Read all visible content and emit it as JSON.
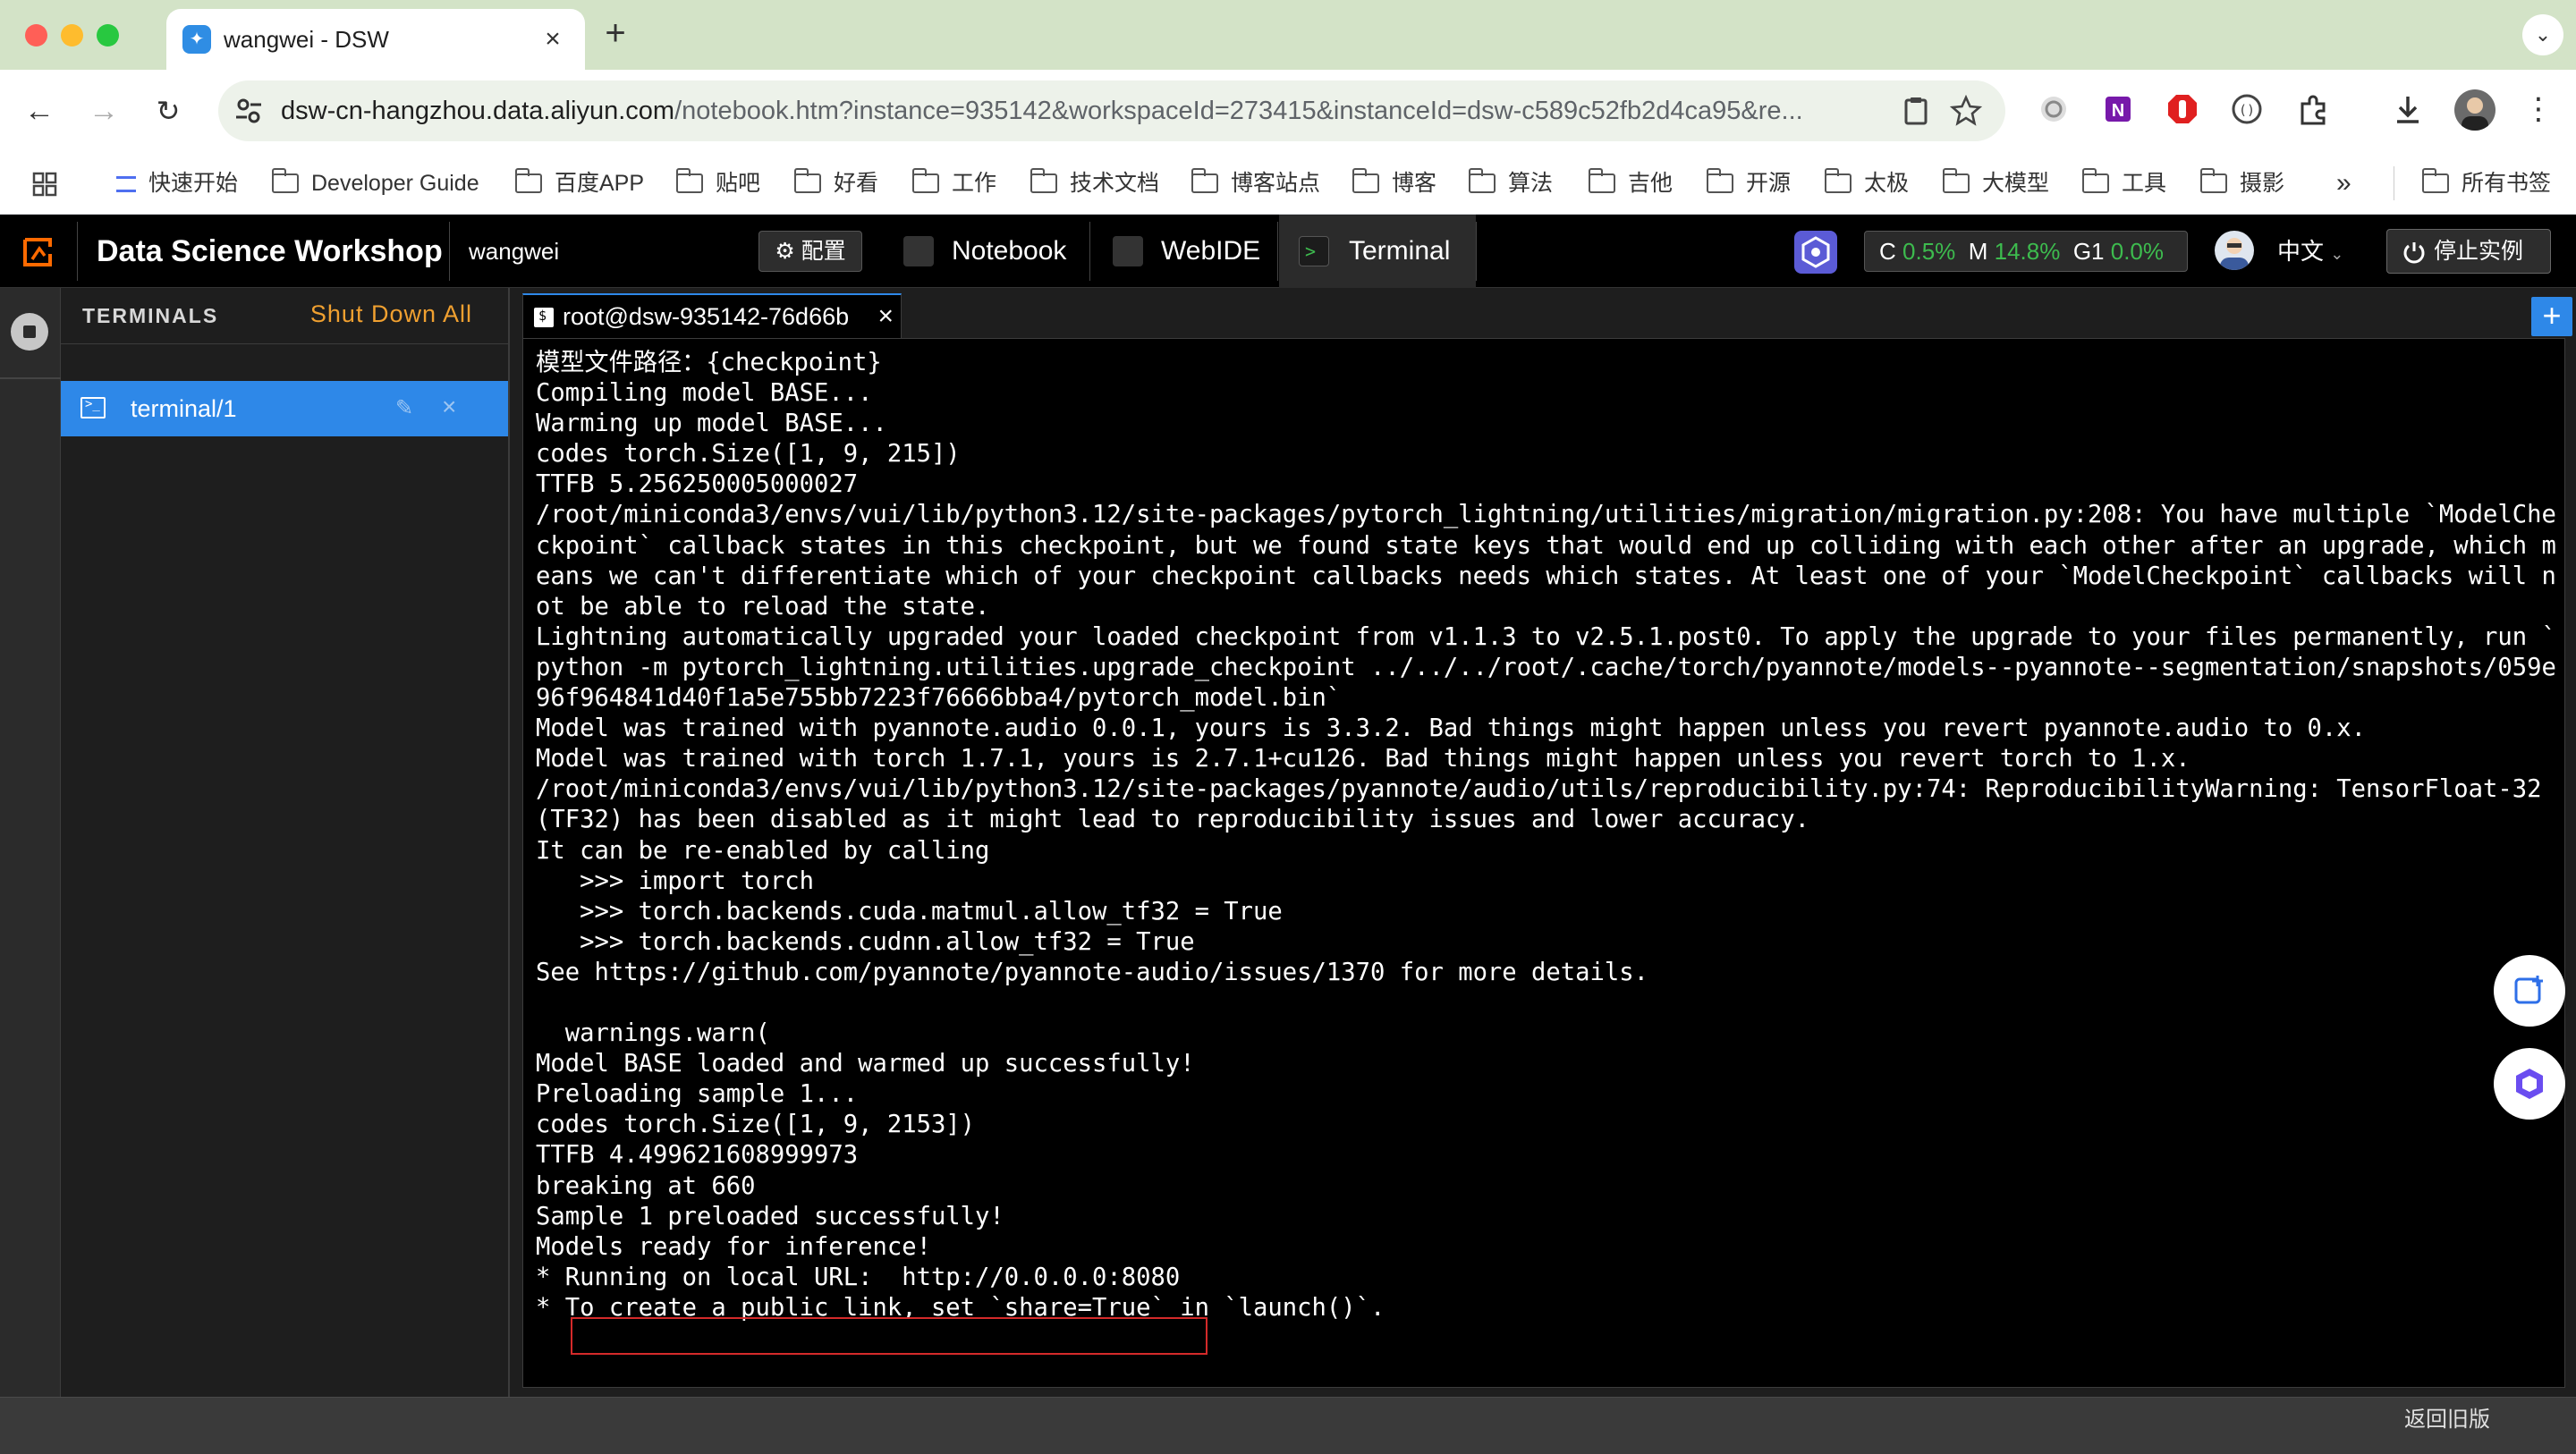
{
  "browser": {
    "tab_title": "wangwei - DSW",
    "tab_favicon": "dsw-logo",
    "new_tab": "+",
    "url_host": "dsw-cn-hangzhou.data.aliyun.com",
    "url_rest": "/notebook.htm?instance=935142&workspaceId=273415&instanceId=dsw-c589c52fb2d4ca95&re..."
  },
  "bookmarks": [
    {
      "label": "快速开始"
    },
    {
      "label": "Developer Guide"
    },
    {
      "label": "百度APP"
    },
    {
      "label": "贴吧"
    },
    {
      "label": "好看"
    },
    {
      "label": "工作"
    },
    {
      "label": "技术文档"
    },
    {
      "label": "博客站点"
    },
    {
      "label": "博客"
    },
    {
      "label": "算法"
    },
    {
      "label": "吉他"
    },
    {
      "label": "开源"
    },
    {
      "label": "太极"
    },
    {
      "label": "大模型"
    },
    {
      "label": "工具"
    },
    {
      "label": "摄影"
    },
    {
      "label": "所有书签"
    }
  ],
  "header": {
    "app_title": "Data Science Workshop",
    "user": "wangwei",
    "config_label": "配置",
    "tabs": [
      {
        "label": "Notebook"
      },
      {
        "label": "WebIDE"
      },
      {
        "label": "Terminal"
      }
    ],
    "metrics": {
      "c_label": "C",
      "c_value": "0.5%",
      "m_label": "M",
      "m_value": "14.8%",
      "g_label": "G1",
      "g_value": "0.0%"
    },
    "language": "中文",
    "stop_label": "停止实例"
  },
  "sidebar": {
    "title": "TERMINALS",
    "shutdown_all": "Shut Down All",
    "items": [
      {
        "label": "terminal/1"
      }
    ]
  },
  "terminal": {
    "tab_title": "root@dsw-935142-76d66b",
    "output": "模型文件路径：{checkpoint}\nCompiling model BASE...\nWarming up model BASE...\ncodes torch.Size([1, 9, 215])\nTTFB 5.256250005000027\n/root/miniconda3/envs/vui/lib/python3.12/site-packages/pytorch_lightning/utilities/migration/migration.py:208: You have multiple `ModelChe\nckpoint` callback states in this checkpoint, but we found state keys that would end up colliding with each other after an upgrade, which m\neans we can't differentiate which of your checkpoint callbacks needs which states. At least one of your `ModelCheckpoint` callbacks will n\not be able to reload the state.\nLightning automatically upgraded your loaded checkpoint from v1.1.3 to v2.5.1.post0. To apply the upgrade to your files permanently, run `\npython -m pytorch_lightning.utilities.upgrade_checkpoint ../../../root/.cache/torch/pyannote/models--pyannote--segmentation/snapshots/059e\n96f964841d40f1a5e755bb7223f76666bba4/pytorch_model.bin`\nModel was trained with pyannote.audio 0.0.1, yours is 3.3.2. Bad things might happen unless you revert pyannote.audio to 0.x.\nModel was trained with torch 1.7.1, yours is 2.7.1+cu126. Bad things might happen unless you revert torch to 1.x.\n/root/miniconda3/envs/vui/lib/python3.12/site-packages/pyannote/audio/utils/reproducibility.py:74: ReproducibilityWarning: TensorFloat-32\n(TF32) has been disabled as it might lead to reproducibility issues and lower accuracy.\nIt can be re-enabled by calling\n   >>> import torch\n   >>> torch.backends.cuda.matmul.allow_tf32 = True\n   >>> torch.backends.cudnn.allow_tf32 = True\nSee https://github.com/pyannote/pyannote-audio/issues/1370 for more details.\n\n  warnings.warn(\nModel BASE loaded and warmed up successfully!\nPreloading sample 1...\ncodes torch.Size([1, 9, 2153])\nTTFB 4.499621608999973\nbreaking at 660\nSample 1 preloaded successfully!\nModels ready for inference!\n* Running on local URL:  http://0.0.0.0:8080\n* To create a public link, set `share=True` in `launch()`."
  },
  "footer": {
    "return_old": "返回旧版"
  },
  "colors": {
    "accent": "#2e88e8",
    "warning": "#f0a030",
    "metric_green": "#3dbb4e",
    "highlight_box": "#d42a2a"
  }
}
